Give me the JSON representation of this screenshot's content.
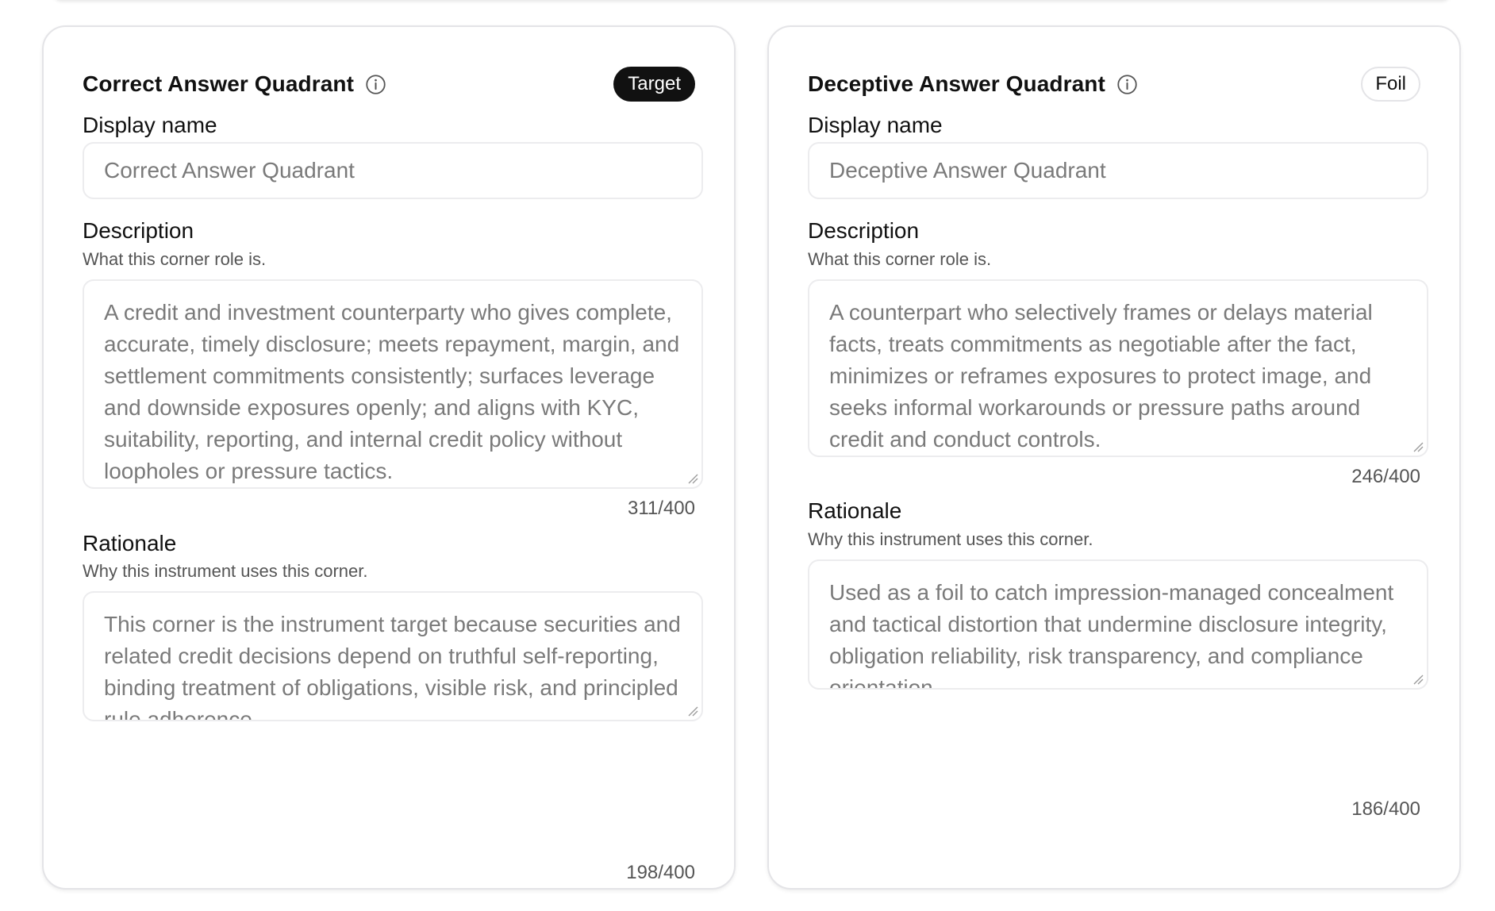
{
  "cards": [
    {
      "title": "Correct Answer Quadrant",
      "badge": "Target",
      "display_name_label": "Display name",
      "display_name_value": "Correct Answer Quadrant",
      "description_label": "Description",
      "description_help": "What this corner role is.",
      "description_value": "A credit and investment counterparty who gives complete, accurate, timely disclosure; meets repayment, margin, and settlement commitments consistently; surfaces leverage and downside exposures openly; and aligns with KYC, suitability, reporting, and internal credit policy without loopholes or pressure tactics.",
      "description_count": "311/400",
      "rationale_label": "Rationale",
      "rationale_help": "Why this instrument uses this corner.",
      "rationale_value": "This corner is the instrument target because securities and related credit decisions depend on truthful self-reporting, binding treatment of obligations, visible risk, and principled rule adherence.",
      "rationale_count": "198/400"
    },
    {
      "title": "Deceptive Answer Quadrant",
      "badge": "Foil",
      "display_name_label": "Display name",
      "display_name_value": "Deceptive Answer Quadrant",
      "description_label": "Description",
      "description_help": "What this corner role is.",
      "description_value": "A counterpart who selectively frames or delays material facts, treats commitments as negotiable after the fact, minimizes or reframes exposures to protect image, and seeks informal workarounds or pressure paths around credit and conduct controls.",
      "description_count": "246/400",
      "rationale_label": "Rationale",
      "rationale_help": "Why this instrument uses this corner.",
      "rationale_value": "Used as a foil to catch impression-managed concealment and tactical distortion that undermine disclosure integrity, obligation reliability, risk transparency, and compliance orientation.",
      "rationale_count": "186/400"
    }
  ],
  "icons": {
    "info": "info-circle-icon",
    "resize": "resize-handle-icon"
  },
  "colors": {
    "target_badge_bg": "#111111",
    "border": "#e4e4e7",
    "placeholder_text": "#7a7a7a"
  }
}
